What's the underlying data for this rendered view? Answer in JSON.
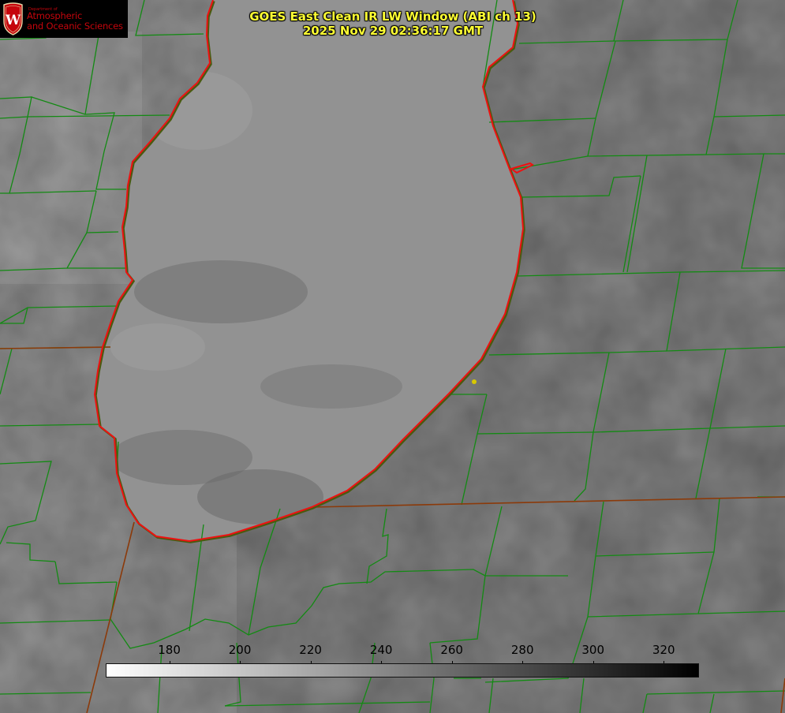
{
  "title": {
    "line1": "GOES East Clean IR LW Window (ABI ch 13)",
    "line2": "2025 Nov 29 02:36:17 GMT"
  },
  "logo": {
    "dept": "Department of",
    "line1": "Atmospheric",
    "line2": "and Oceanic Sciences",
    "crest_letter": "W"
  },
  "colorbar": {
    "min": 162,
    "max": 330,
    "ticks": [
      180,
      200,
      220,
      240,
      260,
      280,
      300,
      320
    ],
    "tick_labels": [
      "180",
      "200",
      "220",
      "240",
      "260",
      "280",
      "300",
      "320"
    ],
    "color_low": "#ffffff",
    "color_high": "#000000"
  },
  "colors": {
    "county_lines": "#138a13",
    "lake_outline": "#ee1111",
    "state_lines": "#8b3a0a",
    "title_text": "#ffff33",
    "marker": "#d8c800",
    "logo_red": "#c5050c"
  }
}
